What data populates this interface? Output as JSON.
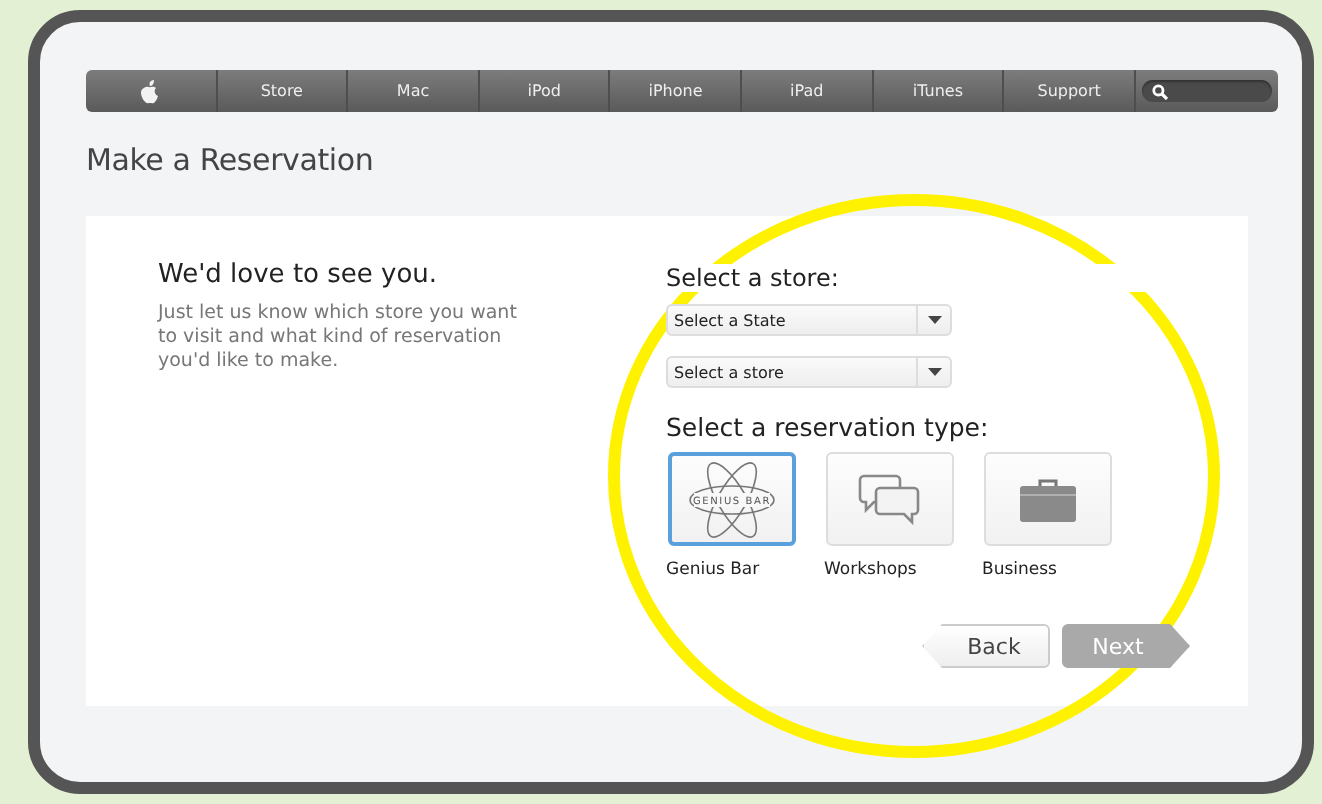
{
  "nav": {
    "items": [
      "Store",
      "Mac",
      "iPod",
      "iPhone",
      "iPad",
      "iTunes",
      "Support"
    ]
  },
  "page_title": "Make a Reservation",
  "intro": {
    "heading": "We'd love to see you.",
    "text": "Just let us know which store you want to visit and what kind of reservation you'd like to make."
  },
  "store": {
    "heading": "Select a store:",
    "dropdowns": [
      "Select a State",
      "Select a store"
    ]
  },
  "reservation": {
    "heading": "Select a reservation type:",
    "types": [
      {
        "kind": "genius",
        "label": "Genius Bar",
        "logo_text": "GENIUS BAR",
        "selected": true
      },
      {
        "kind": "workshops",
        "label": "Workshops",
        "selected": false
      },
      {
        "kind": "business",
        "label": "Business",
        "selected": false
      }
    ]
  },
  "buttons": [
    {
      "kind": "back",
      "label": "Back",
      "disabled": false
    },
    {
      "kind": "next",
      "label": "Next",
      "disabled": true
    }
  ]
}
